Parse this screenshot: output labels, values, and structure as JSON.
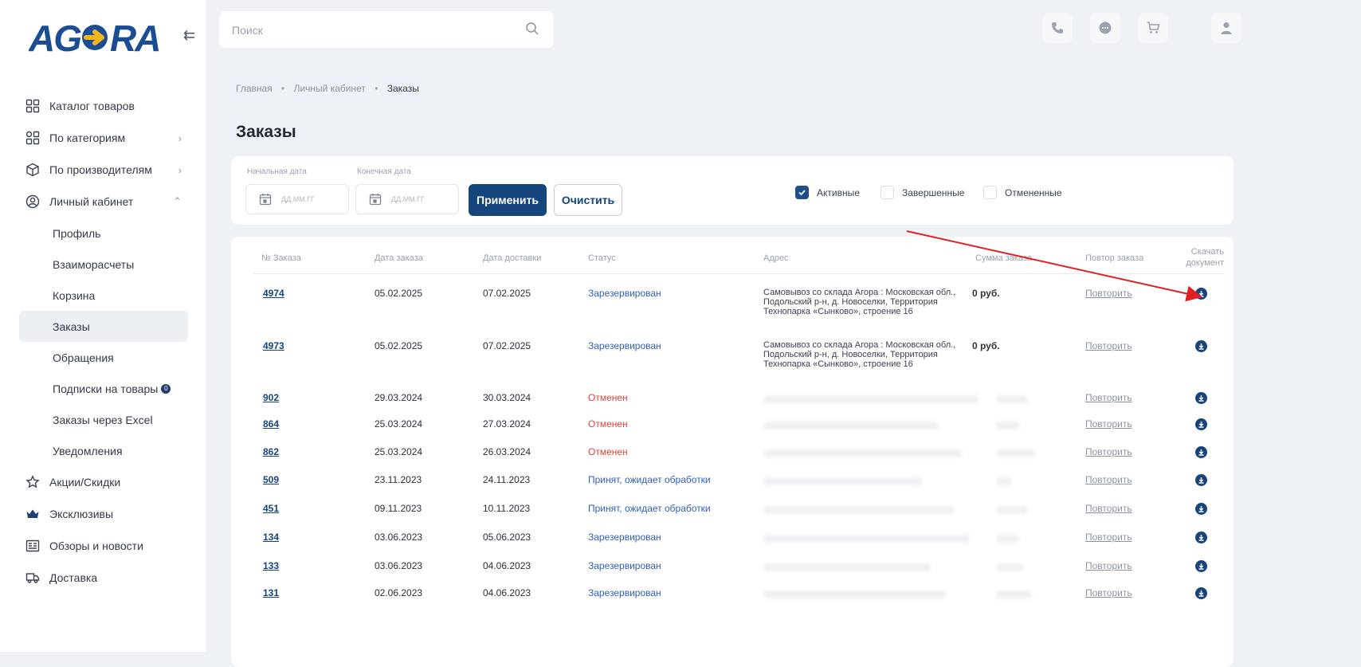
{
  "brand": {
    "logo_text": "AGORA"
  },
  "sidebar": {
    "items": [
      {
        "label": "Каталог товаров",
        "icon": "grid-icon"
      },
      {
        "label": "По категориям",
        "icon": "category-icon",
        "chevron": "›"
      },
      {
        "label": "По производителям",
        "icon": "box-icon",
        "chevron": "›"
      },
      {
        "label": "Личный кабинет",
        "icon": "user-circle-icon",
        "chevron": "⌃"
      }
    ],
    "sub_items": [
      "Профиль",
      "Взаиморасчеты",
      "Корзина",
      "Заказы",
      "Обращения",
      "Подписки на товары",
      "Заказы через Excel",
      "Уведомления"
    ],
    "active_sub": "Заказы",
    "subscriptions_badge": "0",
    "bottom_items": [
      {
        "label": "Акции/Скидки",
        "icon": "star-icon"
      },
      {
        "label": "Эксклюзивы",
        "icon": "crown-icon"
      },
      {
        "label": "Обзоры и новости",
        "icon": "news-icon"
      },
      {
        "label": "Доставка",
        "icon": "truck-icon"
      }
    ]
  },
  "header": {
    "search_placeholder": "Поиск",
    "icons": [
      "phone-icon",
      "chat-icon",
      "cart-icon",
      "user-icon"
    ]
  },
  "breadcrumb": [
    "Главная",
    "Личный кабинет",
    "Заказы"
  ],
  "page_title": "Заказы",
  "filters": {
    "start_label": "Начальная дата",
    "end_label": "Конечная дата",
    "date_placeholder": "ДД.ММ.ГГ",
    "apply_label": "Применить",
    "clear_label": "Очистить",
    "checkboxes": [
      {
        "label": "Активные",
        "checked": true
      },
      {
        "label": "Завершенные",
        "checked": false
      },
      {
        "label": "Отмененные",
        "checked": false
      }
    ]
  },
  "table": {
    "columns": [
      "№ Заказа",
      "Дата заказа",
      "Дата доставки",
      "Статус",
      "Адрес",
      "Сумма заказа",
      "Повтор заказа",
      "Скачать документ"
    ],
    "repeat_label": "Повторить",
    "rows": [
      {
        "no": "4974",
        "date": "05.02.2025",
        "delivery": "07.02.2025",
        "status": "Зарезервирован",
        "status_color": "#2f5fb8",
        "address": "Самовывоз со склада Агора : Московская обл., Подольский р-н, д. Новоселки, Территория Технопарка «Сынково», строение 16",
        "sum": "0 руб."
      },
      {
        "no": "4973",
        "date": "05.02.2025",
        "delivery": "07.02.2025",
        "status": "Зарезервирован",
        "status_color": "#2f5fb8",
        "address": "Самовывоз со склада Агора : Московская обл., Подольский р-н, д. Новоселки, Территория Технопарка «Сынково», строение 16",
        "sum": "0 руб."
      },
      {
        "no": "902",
        "date": "29.03.2024",
        "delivery": "30.03.2024",
        "status": "Отменен",
        "status_color": "#e0413b",
        "address": "",
        "sum": ""
      },
      {
        "no": "864",
        "date": "25.03.2024",
        "delivery": "27.03.2024",
        "status": "Отменен",
        "status_color": "#e0413b",
        "address": "",
        "sum": ""
      },
      {
        "no": "862",
        "date": "25.03.2024",
        "delivery": "26.03.2024",
        "status": "Отменен",
        "status_color": "#e0413b",
        "address": "",
        "sum": ""
      },
      {
        "no": "509",
        "date": "23.11.2023",
        "delivery": "24.11.2023",
        "status": "Принят, ожидает обработки",
        "status_color": "#2f5fb8",
        "address": "",
        "sum": ""
      },
      {
        "no": "451",
        "date": "09.11.2023",
        "delivery": "10.11.2023",
        "status": "Принят, ожидает обработки",
        "status_color": "#2f5fb8",
        "address": "",
        "sum": ""
      },
      {
        "no": "134",
        "date": "03.06.2023",
        "delivery": "05.06.2023",
        "status": "Зарезервирован",
        "status_color": "#2f5fb8",
        "address": "",
        "sum": ""
      },
      {
        "no": "133",
        "date": "03.06.2023",
        "delivery": "04.06.2023",
        "status": "Зарезервирован",
        "status_color": "#2f5fb8",
        "address": "",
        "sum": ""
      },
      {
        "no": "131",
        "date": "02.06.2023",
        "delivery": "04.06.2023",
        "status": "Зарезервирован",
        "status_color": "#2f5fb8",
        "address": "",
        "sum": ""
      }
    ]
  },
  "colors": {
    "primary": "#15457c",
    "annotation_arrow": "#e02020"
  }
}
